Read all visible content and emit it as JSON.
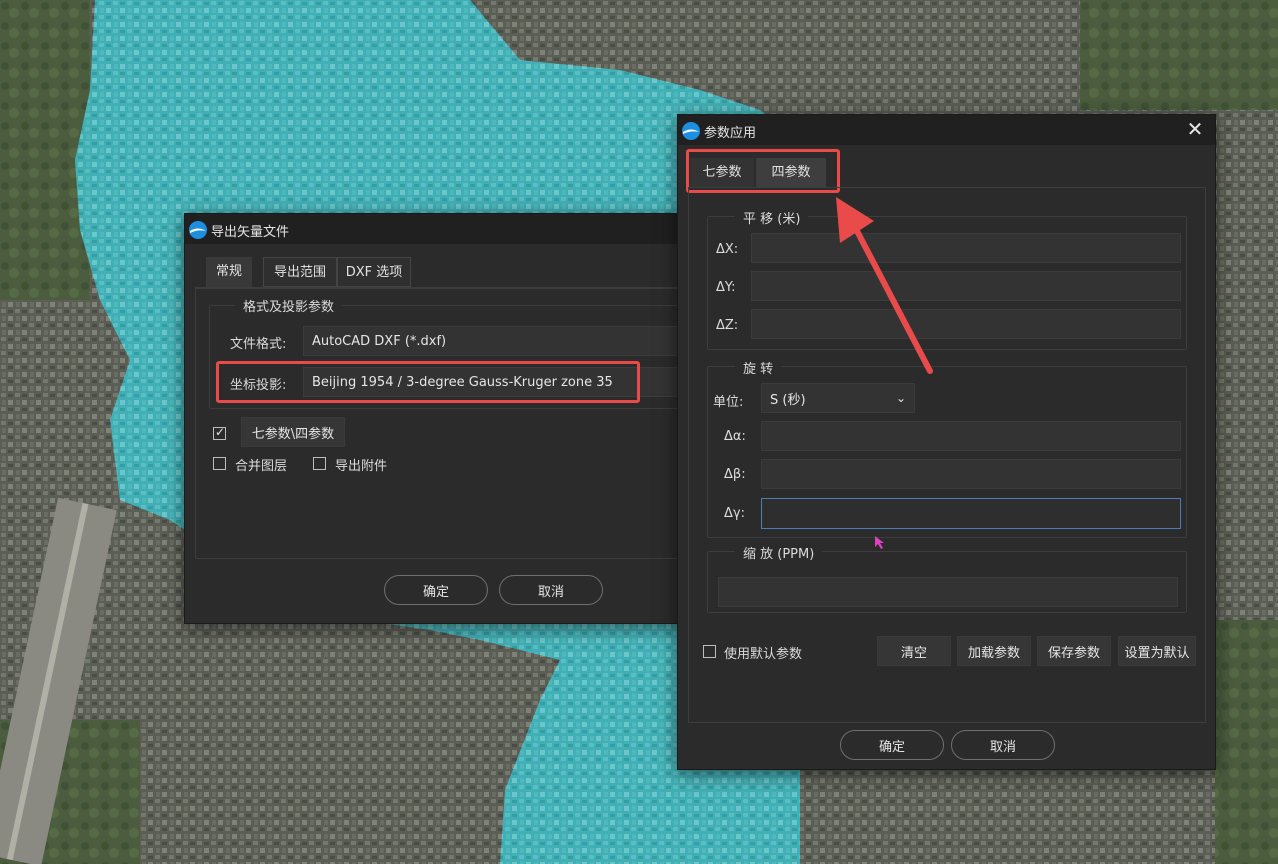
{
  "export_dialog": {
    "title": "导出矢量文件",
    "tabs": [
      "常规",
      "导出范围",
      "DXF 选项"
    ],
    "group_title": "格式及投影参数",
    "format_label": "文件格式:",
    "format_value": "AutoCAD DXF (*.dxf)",
    "projection_label": "坐标投影:",
    "projection_value": "Beijing 1954 / 3-degree Gauss-Kruger zone 35",
    "params_button": "七参数\\四参数",
    "params_checked": true,
    "merge_layers_label": "合并图层",
    "merge_layers_checked": false,
    "export_attach_label": "导出附件",
    "export_attach_checked": false,
    "ok": "确定",
    "cancel": "取消"
  },
  "params_dialog": {
    "title": "参数应用",
    "close_glyph": "✕",
    "tabs": [
      "七参数",
      "四参数"
    ],
    "translation": {
      "title": "平 移 (米)",
      "dx_label": "ΔX:",
      "dy_label": "ΔY:",
      "dz_label": "ΔZ:",
      "dx": "",
      "dy": "",
      "dz": ""
    },
    "rotation": {
      "title": "旋 转",
      "unit_label": "单位:",
      "unit_value": "S (秒)",
      "alpha_label": "Δα:",
      "beta_label": "Δβ:",
      "gamma_label": "Δγ:",
      "alpha": "",
      "beta": "",
      "gamma": ""
    },
    "scale": {
      "title": "缩 放 (PPM)",
      "value": ""
    },
    "use_default_label": "使用默认参数",
    "use_default_checked": false,
    "buttons": {
      "clear": "清空",
      "load": "加载参数",
      "save": "保存参数",
      "set_default": "设置为默认"
    },
    "ok": "确定",
    "cancel": "取消"
  },
  "colors": {
    "highlight": "#e94b4b",
    "water": "#3fb7be",
    "dialog_bg": "#2b2b2b"
  }
}
